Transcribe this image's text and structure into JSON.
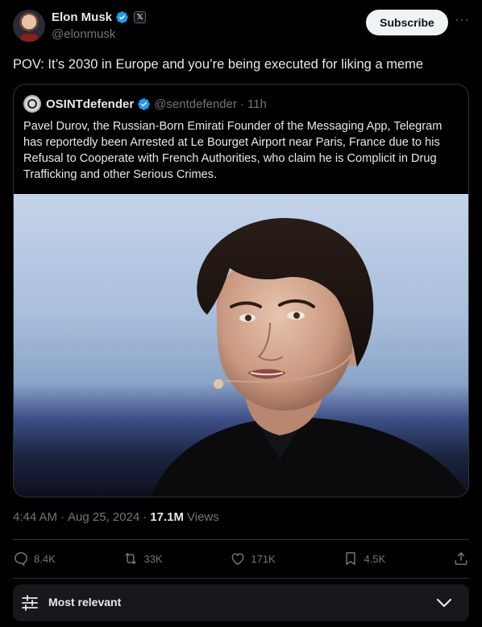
{
  "author": {
    "name": "Elon Musk",
    "handle": "@elonmusk",
    "x_badge": "𝕏",
    "subscribe_label": "Subscribe",
    "more_label": "···"
  },
  "post": {
    "text": "POV: It’s 2030 in Europe and you’re being executed for liking a meme"
  },
  "quoted": {
    "name": "OSINTdefender",
    "handle": "@sentdefender",
    "separator": "·",
    "time": "11h",
    "text": "Pavel Durov, the Russian-Born Emirati Founder of the Messaging App, Telegram has reportedly been Arrested at Le Bourget Airport near Paris, France due to his Refusal to Cooperate with French Authorities, who claim he is Complicit in Drug Trafficking and other Serious Crimes."
  },
  "meta": {
    "time": "4:44 AM",
    "separator": "·",
    "date": "Aug 25, 2024",
    "separator2": "·",
    "views_count": "17.1M",
    "views_label": "Views"
  },
  "actions": {
    "replies": "8.4K",
    "reposts": "33K",
    "likes": "171K",
    "bookmarks": "4.5K"
  },
  "sort": {
    "label": "Most relevant"
  },
  "colors": {
    "background": "#000000",
    "accent": "#1d9bf0",
    "muted": "#71767b",
    "border": "#2f3336"
  }
}
